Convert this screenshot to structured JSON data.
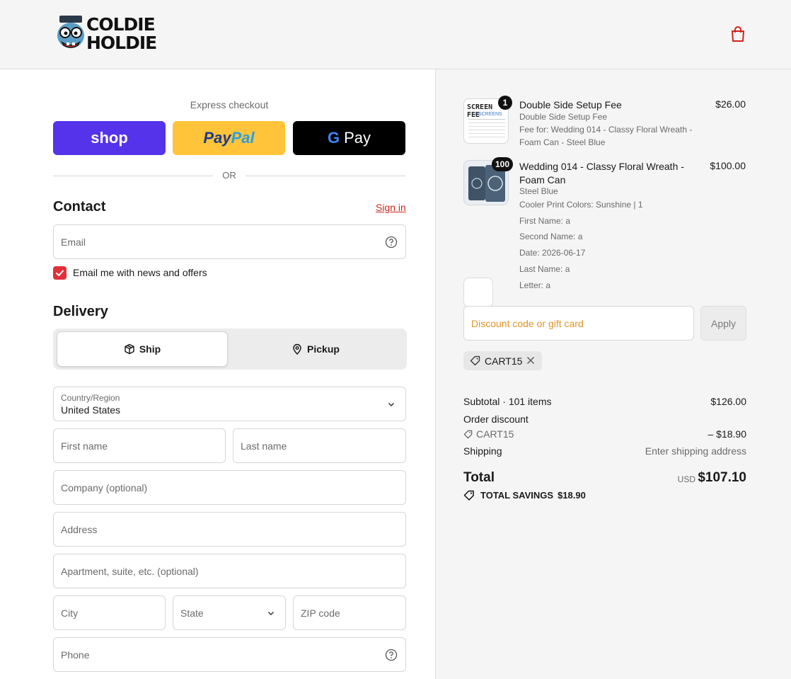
{
  "brand": {
    "logo_text_line1": "COLDIE",
    "logo_text_line2": "HOLDIE"
  },
  "express": {
    "title": "Express checkout",
    "shop_label": "shop",
    "paypal_label_1": "Pay",
    "paypal_label_2": "Pal",
    "gpay_g": "G",
    "gpay_label": "Pay",
    "divider": "OR"
  },
  "contact": {
    "title": "Contact",
    "sign_in": "Sign in",
    "email_placeholder": "Email",
    "newsletter_label": "Email me with news and offers",
    "newsletter_checked": true
  },
  "delivery": {
    "title": "Delivery",
    "tab_ship": "Ship",
    "tab_pickup": "Pickup",
    "country_label": "Country/Region",
    "country_value": "United States",
    "first_name": "First name",
    "last_name": "Last name",
    "company": "Company (optional)",
    "address": "Address",
    "apartment": "Apartment, suite, etc. (optional)",
    "city": "City",
    "state": "State",
    "zip": "ZIP code",
    "phone": "Phone"
  },
  "cart": {
    "items": [
      {
        "qty": "1",
        "name": "Double Side Setup Fee",
        "variant": "Double Side Setup Fee",
        "detail": "Fee for: Wedding 014 - Classy Floral Wreath - Foam Can - Steel Blue",
        "price": "$26.00",
        "thumb_title": "SCREEN FEE",
        "thumb_sub": "2 SCREENS"
      },
      {
        "qty": "100",
        "name": "Wedding 014 - Classy Floral Wreath - Foam Can",
        "variant": "Steel Blue",
        "detail": "Cooler Print Colors: Sunshine | 1",
        "props": [
          "First Name: a",
          "Second Name: a",
          "Date: 2026-06-17",
          "Last Name: a",
          "Letter: a"
        ],
        "price": "$100.00"
      }
    ],
    "discount_placeholder": "Discount code or gift card",
    "apply_label": "Apply",
    "applied_code": "CART15"
  },
  "summary": {
    "subtotal_label": "Subtotal · 101 items",
    "subtotal_value": "$126.00",
    "order_discount_label": "Order discount",
    "discount_code": "CART15",
    "discount_value": "– $18.90",
    "shipping_label": "Shipping",
    "shipping_value": "Enter shipping address",
    "total_label": "Total",
    "total_currency": "USD",
    "total_value": "$107.10",
    "savings_label": "TOTAL SAVINGS",
    "savings_value": "$18.90"
  },
  "colors": {
    "accent": "#d0241c",
    "shop_purple": "#5433eb",
    "paypal_yellow": "#ffc43a",
    "discount_placeholder": "#e0952a"
  }
}
